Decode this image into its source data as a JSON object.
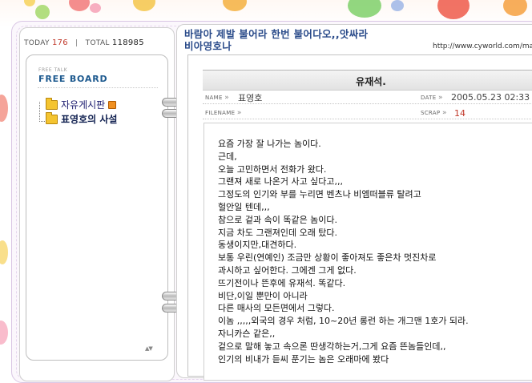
{
  "counter": {
    "today_label": "TODAY",
    "today_value": "176",
    "total_label": "TOTAL",
    "total_value": "118985"
  },
  "board": {
    "subtitle": "FREE TALK",
    "title": "FREE BOARD",
    "menu": [
      {
        "label": "자유게시판",
        "has_new": true
      },
      {
        "label": "표영호의 사설",
        "has_new": false
      }
    ]
  },
  "header": {
    "title_line1": "바람아 제발 불어라 한번 불어다오,,앗싸라",
    "title_line2": "비아영호나",
    "url": "http://www.cyworld.com/mac"
  },
  "post": {
    "title": "유재석.",
    "name_label": "NAME",
    "name_value": "표영호",
    "date_label": "DATE",
    "date_value": "2005.05.23 02:33",
    "filename_label": "FILENAME",
    "scrap_label": "SCRAP",
    "scrap_value": "14",
    "body": [
      "요즘 가장 잘 나가는 놈이다.",
      "근데,",
      "오늘 고민하면서 전화가 왔다.",
      "그랜져 새로 나온거 사고 싶다고,,,",
      "그정도의 인기와 부를 누리면 벤츠나 비엠떠블류 탈려고",
      "헐안일 텐데,,,",
      "참으로 겉과 속이 똑같은 놈이다.",
      "지금 차도 그랜져인데 오래 탔다.",
      "동생이지만,대견하다.",
      "보통 우린(연예인) 조금만 상황이 좋아져도 좋은차 멋진차로",
      "과시하고 싶어한다. 그에겐 그게 없다.",
      "뜨기전이나 뜬후에 유재석. 똑같다.",
      "비단,이일 뿐만이 아니라",
      "다른 매사의 모든면에서 그렇다.",
      "이놈 ,,,,,외국의 경우 처럼, 10~20년 롱런 하는 개그맨 1호가 되라.",
      "자니카슨 같은,,",
      "겉으로 말해 놓고 속으론 딴생각하는거,그게 요즘 뜬놈들인데,,",
      "인기의 비내가 듣씨 푼기는 놈은 오래마에 봤다"
    ]
  },
  "colors": {
    "title_blue": "#2a4b8a",
    "board_blue": "#1e5a8f",
    "accent_red": "#c0392b",
    "binder_border": "#d9c6e4"
  },
  "icons": [
    "folder-icon",
    "new-badge-icon",
    "arrow-icon",
    "scroll-down-icon"
  ]
}
